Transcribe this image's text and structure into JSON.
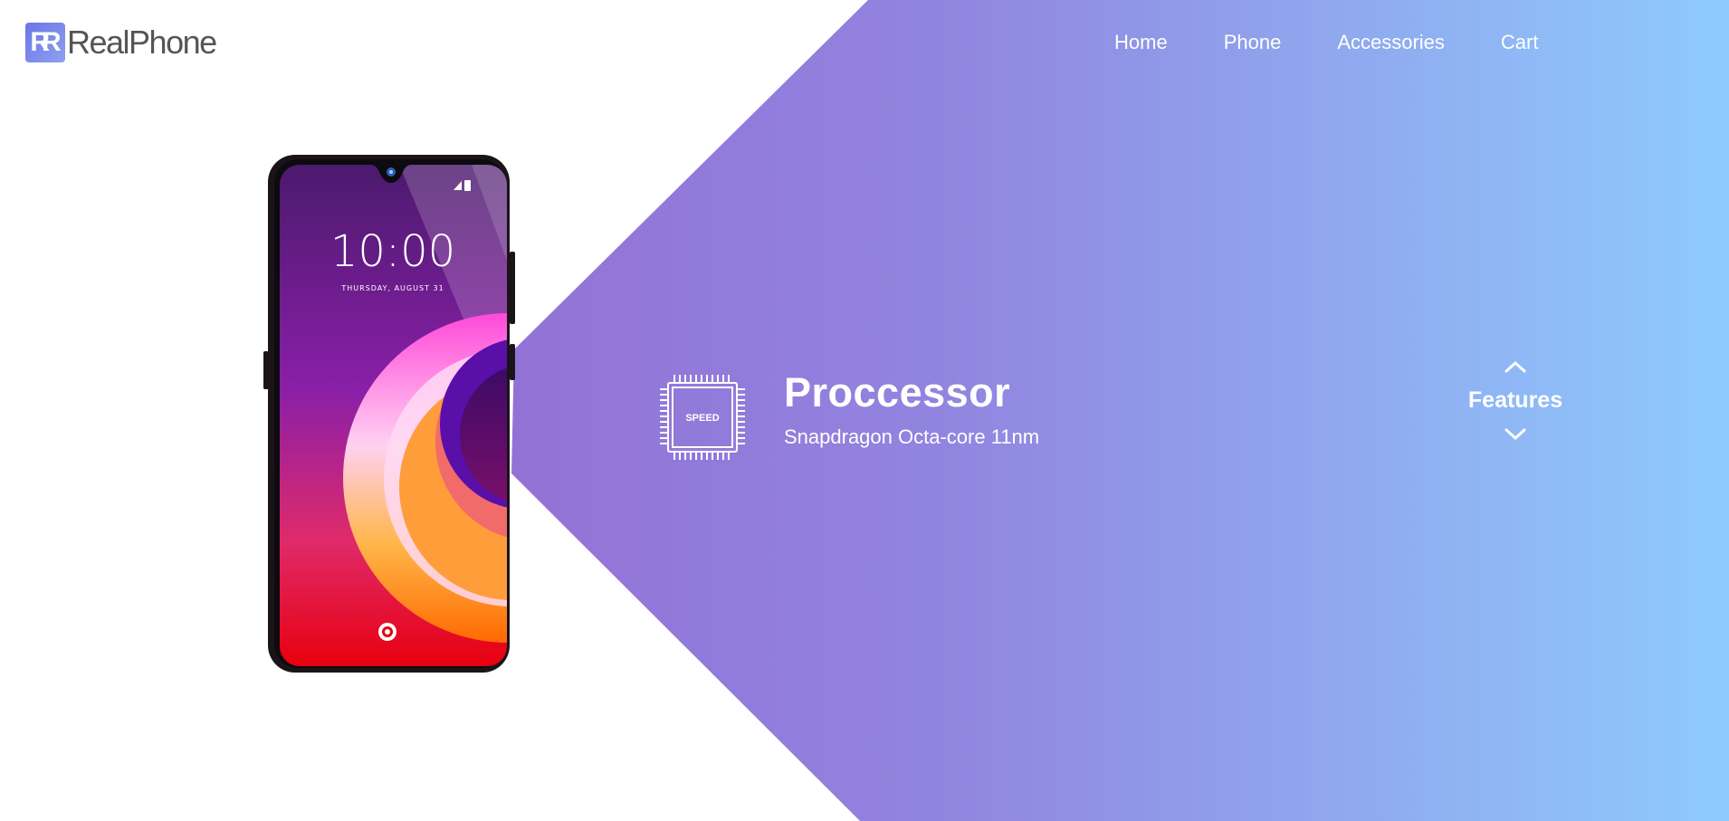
{
  "brand": {
    "logo_mark": "R",
    "name": "RealPhone"
  },
  "nav": {
    "items": [
      {
        "label": "Home"
      },
      {
        "label": "Phone"
      },
      {
        "label": "Accessories"
      },
      {
        "label": "Cart"
      }
    ]
  },
  "phone_screen": {
    "time": "10:00",
    "date": "THURSDAY, AUGUST 31"
  },
  "feature": {
    "chip_label": "SPEED",
    "title": "Proccessor",
    "description": "Snapdragon Octa-core 11nm"
  },
  "features_control": {
    "label": "Features"
  },
  "colors": {
    "gradient_start": "#965cc9",
    "gradient_end": "#8ecbfd",
    "logo_start": "#6a75e6",
    "logo_end": "#8ea0f0"
  },
  "icons": {
    "chip": "chip-icon",
    "up": "chevron-up-icon",
    "down": "chevron-down-icon"
  }
}
